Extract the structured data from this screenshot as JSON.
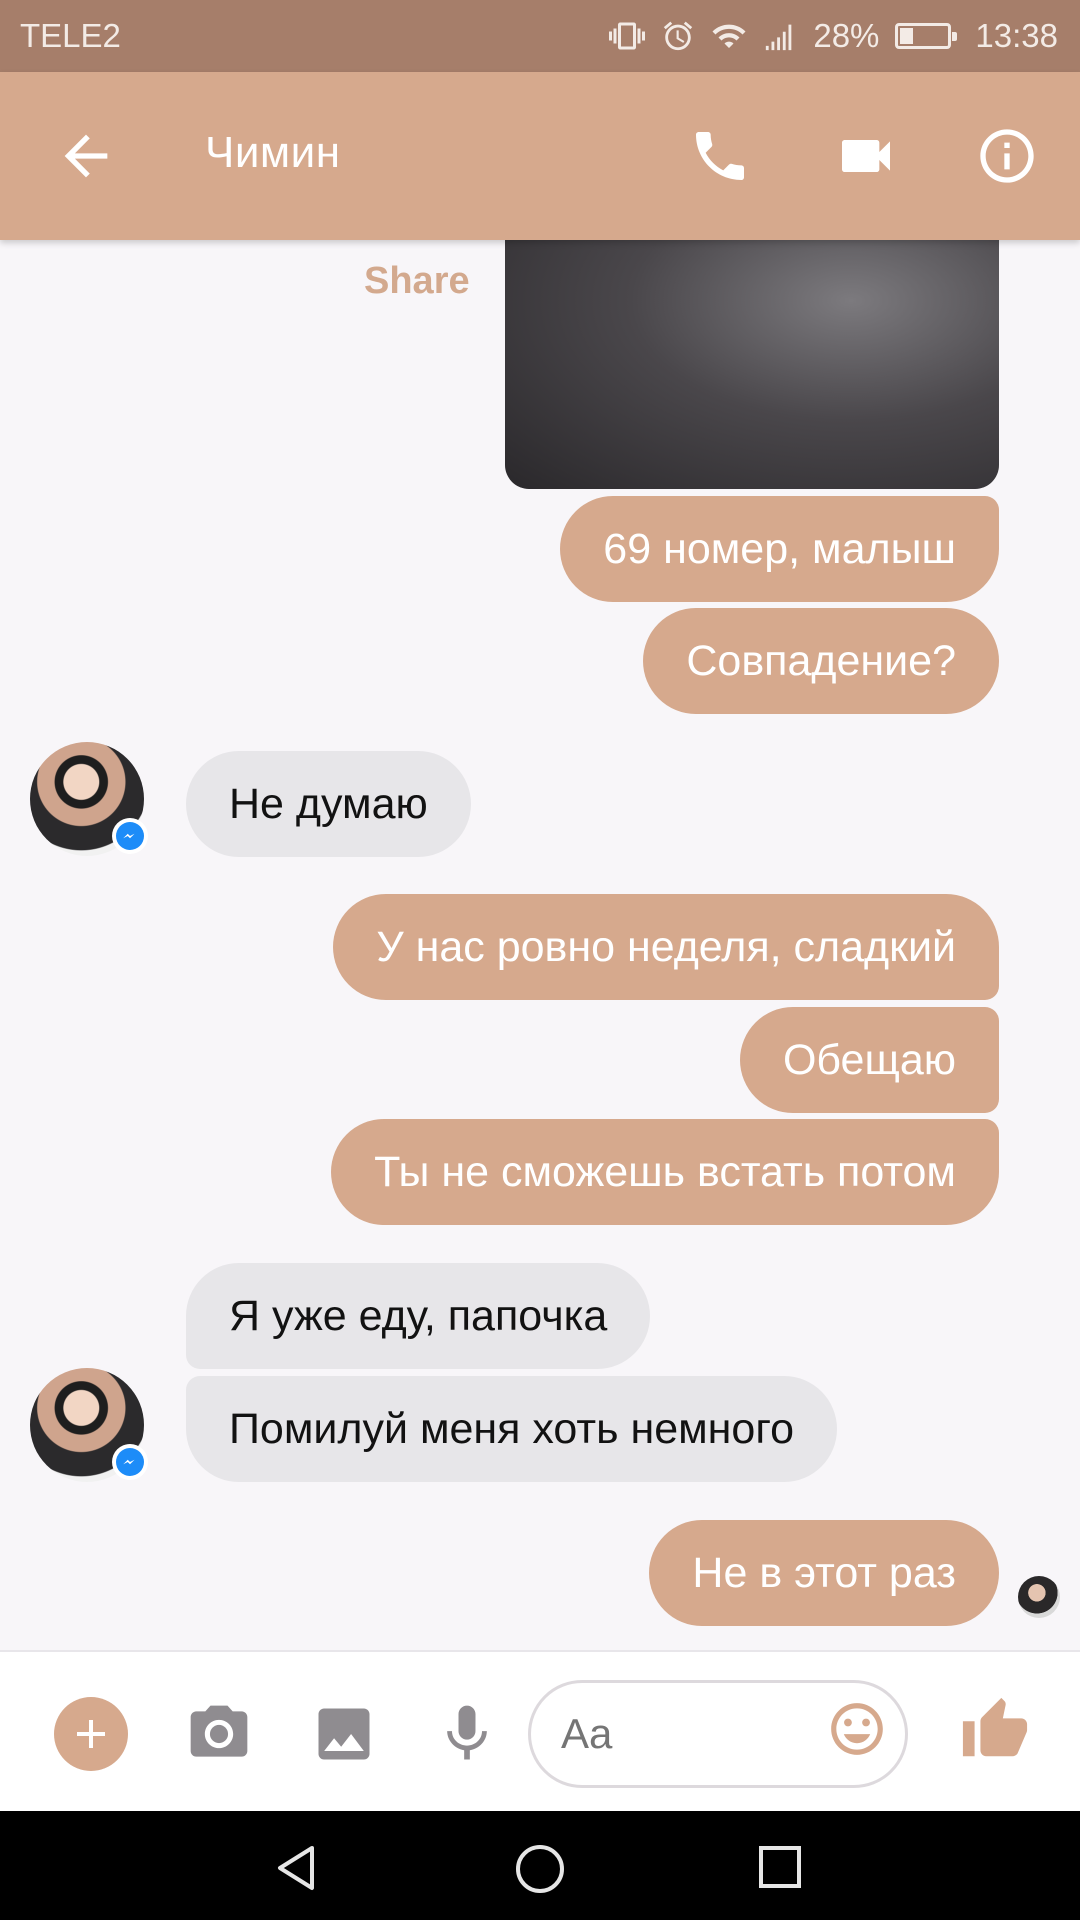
{
  "status_bar": {
    "carrier": "TELE2",
    "battery": "28%",
    "battery_level": 0.28,
    "time": "13:38",
    "icons": [
      "vibrate-icon",
      "alarm-icon",
      "wifi-icon",
      "signal-icon",
      "battery-icon"
    ]
  },
  "header": {
    "contact_name": "Чимин",
    "icons": [
      "back-arrow-icon",
      "phone-icon",
      "video-camera-icon",
      "info-icon"
    ]
  },
  "conversation": {
    "share_label": "Share",
    "messages": [
      {
        "direction": "outgoing",
        "text": "69 номер,  малыш"
      },
      {
        "direction": "outgoing",
        "text": "Совпадение?"
      },
      {
        "direction": "incoming",
        "text": "Не думаю"
      },
      {
        "direction": "outgoing",
        "text": "У нас ровно неделя, сладкий"
      },
      {
        "direction": "outgoing",
        "text": "Обещаю"
      },
      {
        "direction": "outgoing",
        "text": "Ты не сможешь встать потом"
      },
      {
        "direction": "incoming",
        "text": "Я уже еду,  папочка"
      },
      {
        "direction": "incoming",
        "text": "Помилуй меня хоть немного"
      },
      {
        "direction": "outgoing",
        "text": "Не в этот раз"
      }
    ]
  },
  "composer": {
    "placeholder": "Aa",
    "icons": [
      "plus-icon",
      "camera-icon",
      "image-icon",
      "microphone-icon",
      "emoji-icon",
      "thumbs-up-icon"
    ]
  },
  "navigation_bar": {
    "icons": [
      "nav-back-icon",
      "nav-home-icon",
      "nav-recents-icon"
    ]
  },
  "colors": {
    "accent": "#d6a98d",
    "status_bar": "#a67e6a",
    "incoming_bubble": "#e7e6e9",
    "background": "#f8f6f9"
  }
}
